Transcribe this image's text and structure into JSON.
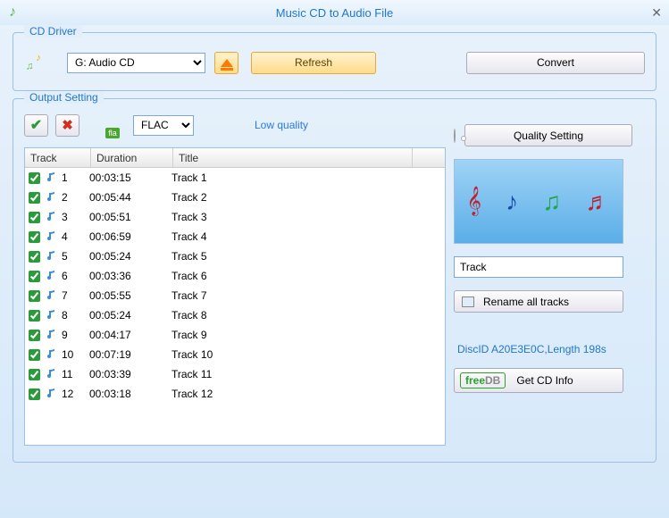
{
  "window": {
    "title": "Music CD to Audio File"
  },
  "cdDriver": {
    "legend": "CD Driver",
    "drive": "G:  Audio CD",
    "refresh": "Refresh",
    "convert": "Convert"
  },
  "output": {
    "legend": "Output Setting",
    "format": "FLAC",
    "quality_label": "Low quality",
    "quality_btn": "Quality Setting",
    "track_name": "Track",
    "rename_btn": "Rename all tracks",
    "disc_info": "DiscID A20E3E0C,Length 198s",
    "getinfo_btn": "Get CD Info",
    "columns": {
      "track": "Track",
      "duration": "Duration",
      "title": "Title"
    },
    "rows": [
      {
        "n": "1",
        "dur": "00:03:15",
        "title": "Track 1"
      },
      {
        "n": "2",
        "dur": "00:05:44",
        "title": "Track 2"
      },
      {
        "n": "3",
        "dur": "00:05:51",
        "title": "Track 3"
      },
      {
        "n": "4",
        "dur": "00:06:59",
        "title": "Track 4"
      },
      {
        "n": "5",
        "dur": "00:05:24",
        "title": "Track 5"
      },
      {
        "n": "6",
        "dur": "00:03:36",
        "title": "Track 6"
      },
      {
        "n": "7",
        "dur": "00:05:55",
        "title": "Track 7"
      },
      {
        "n": "8",
        "dur": "00:05:24",
        "title": "Track 8"
      },
      {
        "n": "9",
        "dur": "00:04:17",
        "title": "Track 9"
      },
      {
        "n": "10",
        "dur": "00:07:19",
        "title": "Track 10"
      },
      {
        "n": "11",
        "dur": "00:03:39",
        "title": "Track 11"
      },
      {
        "n": "12",
        "dur": "00:03:18",
        "title": "Track 12"
      }
    ]
  }
}
